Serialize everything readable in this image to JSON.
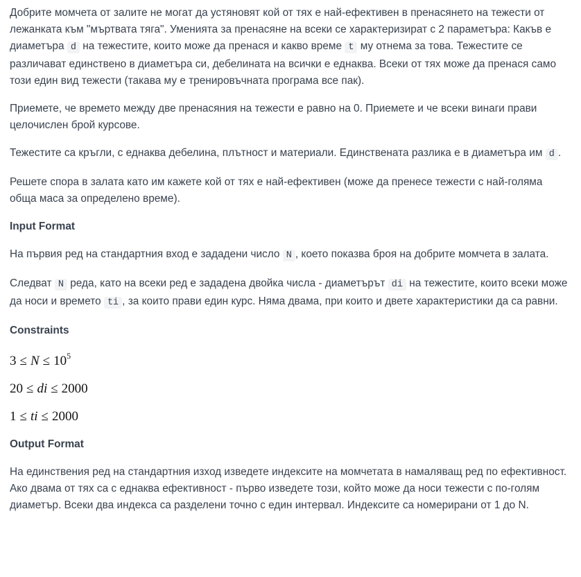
{
  "intro": {
    "p1_a": "Добрите момчета от залите не могат да устяновят кой от тях е най-ефективен в пренасянето на тежести от лежанката към \"мъртвата тяга\". Уменията за пренасяне на всеки се характеризират с 2 параметъра: Какъв е диаметъра ",
    "p1_code_d": "d",
    "p1_b": " на тежестите, които може да пренася и какво време ",
    "p1_code_t": "t",
    "p1_c": " му отнема за това. Тежестите се различават единствено в диаметъра си, дебелината на всички е еднаква. Всеки от тях може да пренася само този един вид тежести (такава му е тренировъчната програма все пак).",
    "p2": "Приемете, че времето между две пренасяния на тежести е равно на 0. Приемете и че всеки винаги прави целочислен брой курсове.",
    "p3_a": "Тежестите са кръгли, с еднаква дебелина, плътност и материали. Единствената разлика е в диаметъра им ",
    "p3_code_d": "d",
    "p3_b": ".",
    "p4": "Решете спора в залата като им кажете кой от тях е най-ефективен (може да пренесе тежести с най-голяма обща маса за определено време)."
  },
  "input_format": {
    "heading": "Input Format",
    "p1_a": "На първия ред на стандартния вход е зададени число ",
    "p1_code_n": "N",
    "p1_b": ", което показва броя на добрите момчета в залата.",
    "p2_a": "Следват ",
    "p2_code_n": "N",
    "p2_b": " реда, като на всеки ред е зададена двойка числа - диаметърът ",
    "p2_code_di": "di",
    "p2_c": " на тежестите, които всеки може да носи и времето ",
    "p2_code_ti": "ti",
    "p2_d": ", за които прави един курс. Няма двама, при които и двете характеристики да са равни."
  },
  "constraints": {
    "heading": "Constraints",
    "c1": {
      "low": "3",
      "rel1": "≤",
      "var": "N",
      "rel2": "≤",
      "base": "10",
      "exp": "5"
    },
    "c2": {
      "low": "20",
      "rel1": "≤",
      "var": "di",
      "rel2": "≤",
      "high": "2000"
    },
    "c3": {
      "low": "1",
      "rel1": "≤",
      "var": "ti",
      "rel2": "≤",
      "high": "2000"
    }
  },
  "output_format": {
    "heading": "Output Format",
    "p1": "На единствения ред на стандартния изход изведете индексите на момчетата в намаляващ ред по ефективност. Ако двама от тях са с еднаква ефективност - първо изведете този, който може да носи тежести с по-голям диаметър. Всеки два индекса са разделени точно с един интервал. Индексите са номерирани от 1 до N."
  }
}
